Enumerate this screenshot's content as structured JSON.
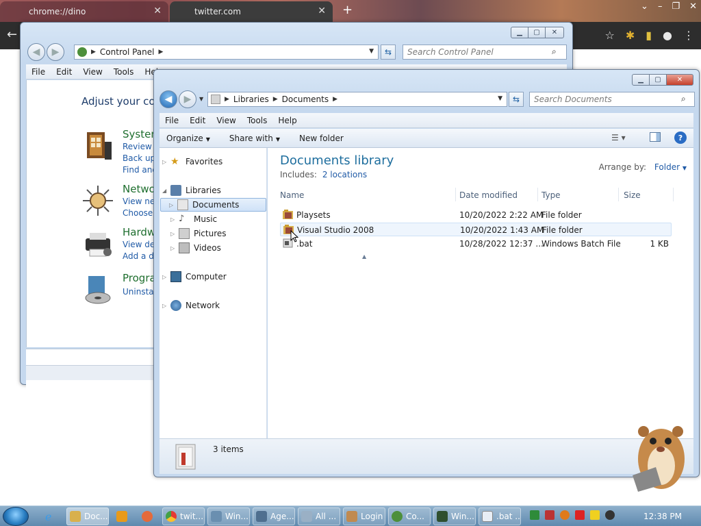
{
  "chrome": {
    "tab1_title": "chrome://dino",
    "tab2_title": "twitter.com"
  },
  "control_panel": {
    "breadcrumb_1": "Control Panel",
    "search_placeholder": "Search Control Panel",
    "menu": [
      "File",
      "Edit",
      "View",
      "Tools",
      "Help"
    ],
    "heading": "Adjust your com",
    "categories": [
      {
        "title": "System",
        "links": [
          "Review yo",
          "Back up yo",
          "Find and f"
        ]
      },
      {
        "title": "Networ",
        "links": [
          "View netw",
          "Choose ho"
        ]
      },
      {
        "title": "Hardwa",
        "links": [
          "View devic",
          "Add a dev"
        ]
      },
      {
        "title": "Program",
        "links": [
          "Uninstall a"
        ]
      }
    ]
  },
  "explorer": {
    "breadcrumb": [
      "Libraries",
      "Documents"
    ],
    "search_placeholder": "Search Documents",
    "menu": [
      "File",
      "Edit",
      "View",
      "Tools",
      "Help"
    ],
    "toolbar": {
      "organize": "Organize",
      "share_with": "Share with",
      "new_folder": "New folder"
    },
    "nav": {
      "favorites": "Favorites",
      "libraries": "Libraries",
      "documents": "Documents",
      "music": "Music",
      "pictures": "Pictures",
      "videos": "Videos",
      "computer": "Computer",
      "network": "Network"
    },
    "library_title": "Documents library",
    "includes_label": "Includes:",
    "includes_link": "2 locations",
    "arrange_label": "Arrange by:",
    "arrange_value": "Folder",
    "columns": {
      "name": "Name",
      "date": "Date modified",
      "type": "Type",
      "size": "Size"
    },
    "files": [
      {
        "name": "Playsets",
        "date": "10/20/2022 2:22 AM",
        "type": "File folder",
        "size": ""
      },
      {
        "name": "Visual Studio 2008",
        "date": "10/20/2022 1:43 AM",
        "type": "File folder",
        "size": ""
      },
      {
        "name": ".bat",
        "date": "10/28/2022 12:37 ...",
        "type": "Windows Batch File",
        "size": "1 KB"
      }
    ],
    "item_count": "3 items"
  },
  "taskbar": {
    "buttons": [
      "Doc...",
      "twit...",
      "Win...",
      "Age...",
      "All ...",
      "Login",
      "Co...",
      "Win...",
      ".bat ..."
    ],
    "clock": "12:38 PM"
  },
  "colors": {
    "accent_blue": "#1f5aa6",
    "link_green": "#1e6e2e",
    "library_title": "#1e6e9e"
  }
}
